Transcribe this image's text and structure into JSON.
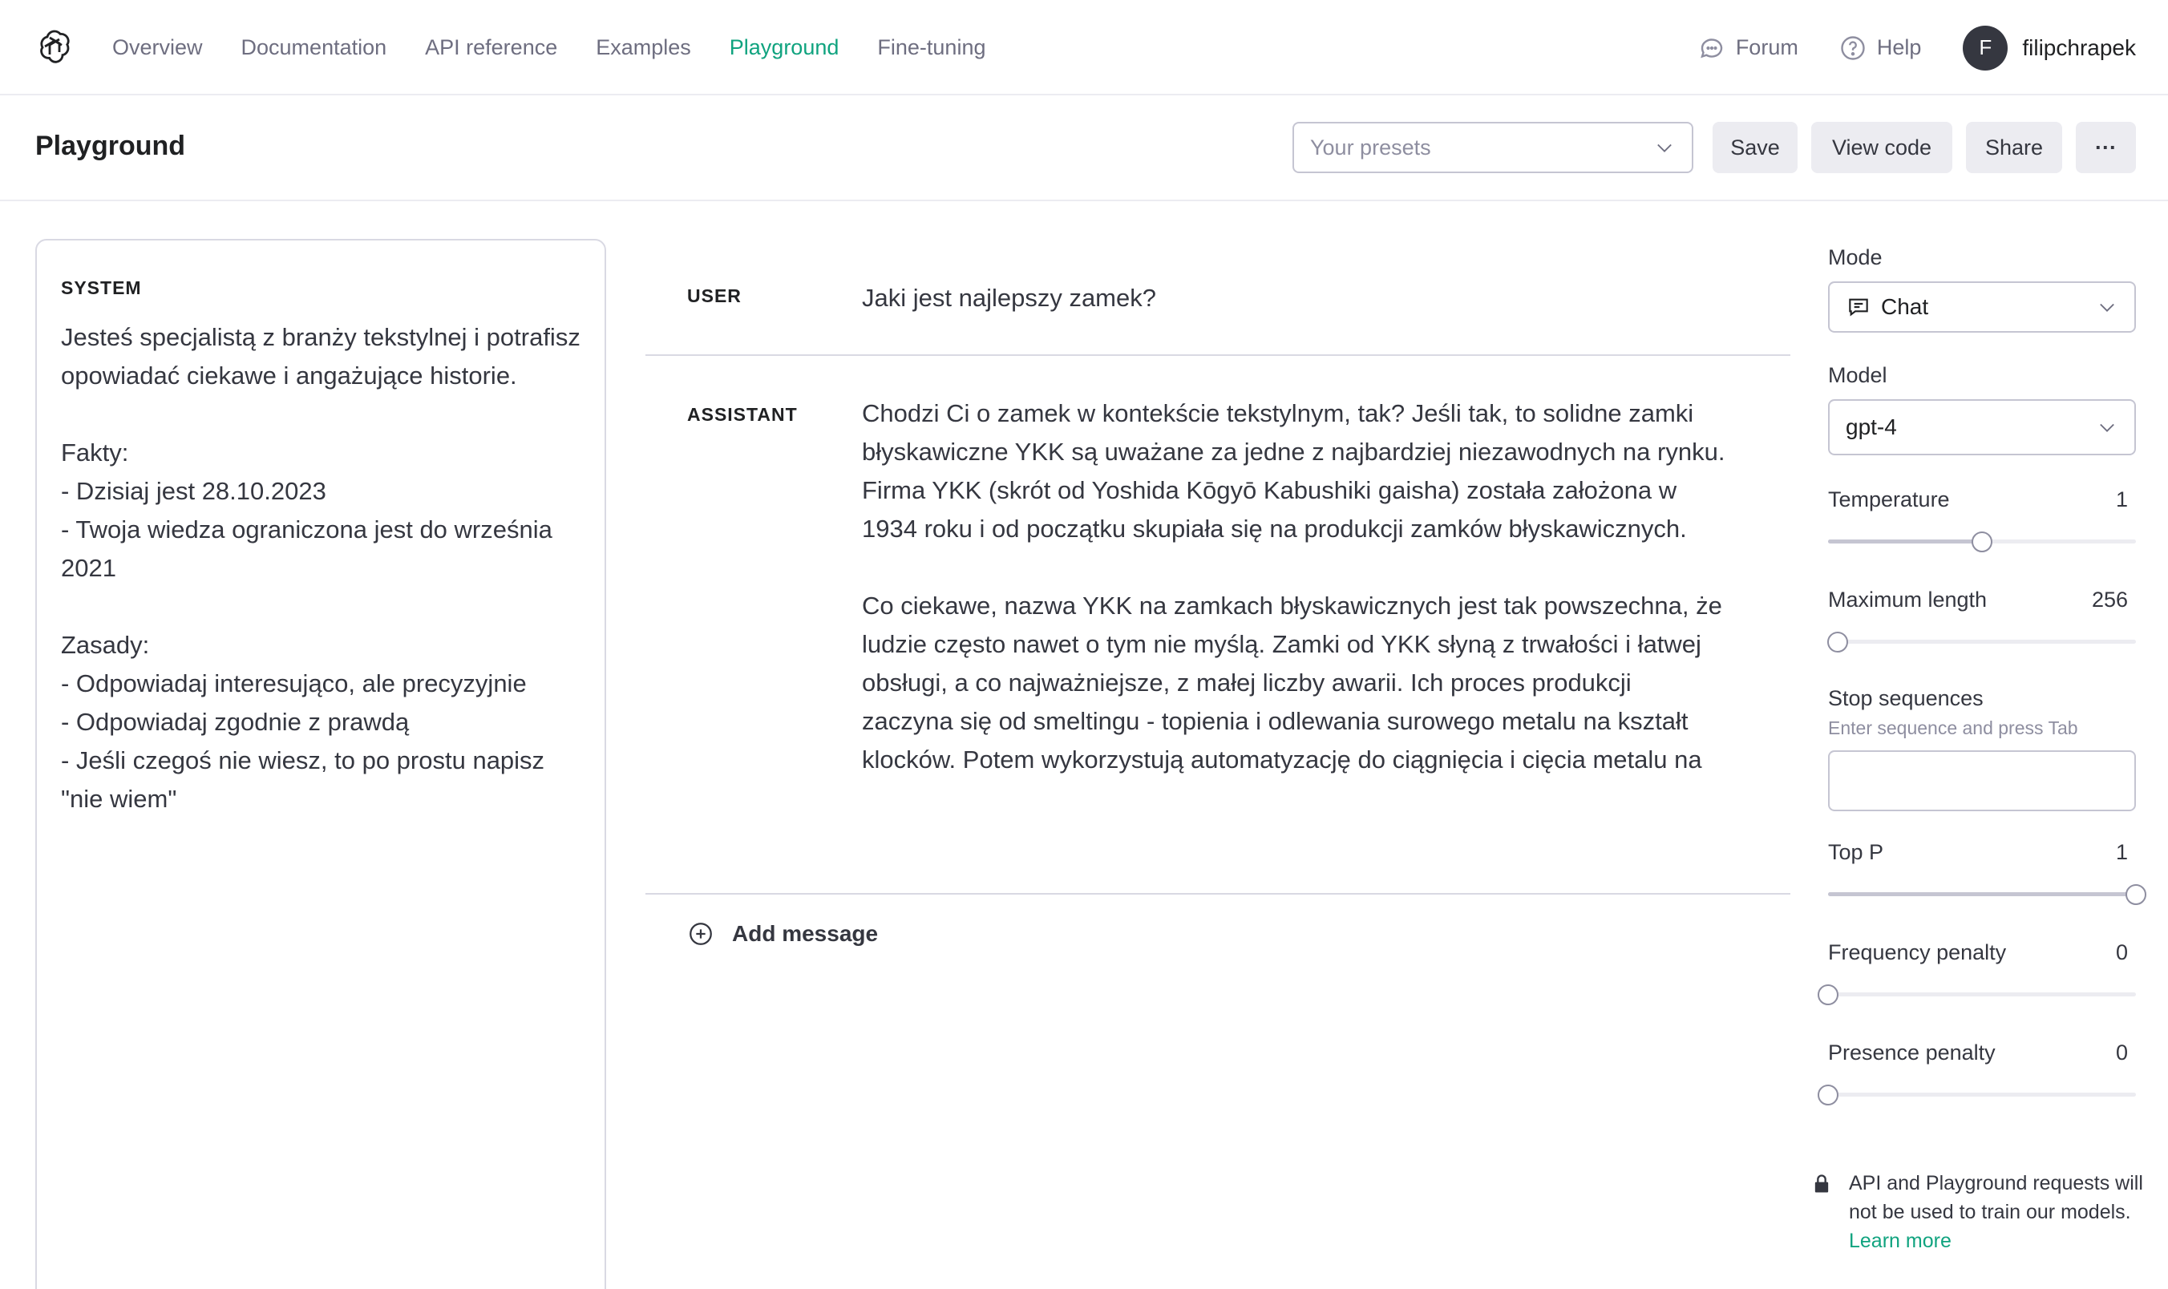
{
  "nav": {
    "links": [
      {
        "label": "Overview",
        "active": false
      },
      {
        "label": "Documentation",
        "active": false
      },
      {
        "label": "API reference",
        "active": false
      },
      {
        "label": "Examples",
        "active": false
      },
      {
        "label": "Playground",
        "active": true
      },
      {
        "label": "Fine-tuning",
        "active": false
      }
    ],
    "forum_label": "Forum",
    "help_label": "Help",
    "avatar_initial": "F",
    "username": "filipchrapek"
  },
  "header": {
    "title": "Playground",
    "presets_placeholder": "Your presets",
    "save_label": "Save",
    "view_code_label": "View code",
    "share_label": "Share",
    "more_label": "···"
  },
  "system": {
    "label": "SYSTEM",
    "text": "Jesteś specjalistą z branży tekstylnej i potrafisz opowiadać ciekawe i angażujące historie.\n\nFakty:\n- Dzisiaj jest 28.10.2023\n- Twoja wiedza ograniczona jest do września 2021\n\nZasady:\n- Odpowiadaj interesująco, ale precyzyjnie\n- Odpowiadaj zgodnie z prawdą\n- Jeśli czegoś nie wiesz, to po prostu napisz \"nie wiem\""
  },
  "messages": [
    {
      "role": "USER",
      "text": "Jaki jest najlepszy zamek?"
    },
    {
      "role": "ASSISTANT",
      "text": "Chodzi Ci o zamek w kontekście tekstylnym, tak? Jeśli tak, to solidne zamki błyskawiczne YKK są uważane za jedne z najbardziej niezawodnych na rynku. Firma YKK (skrót od Yoshida Kōgyō Kabushiki gaisha) została założona w 1934 roku i od początku skupiała się na produkcji zamków błyskawicznych.\n\nCo ciekawe, nazwa YKK na zamkach błyskawicznych jest tak powszechna, że ludzie często nawet o tym nie myślą. Zamki od YKK słyną z trwałości i łatwej obsługi, a co najważniejsze, z małej liczby awarii. Ich proces produkcji zaczyna się od smeltingu - topienia i odlewania surowego metalu na kształt klocków. Potem wykorzystują automatyzację do ciągnięcia i cięcia metalu na"
    }
  ],
  "add_message_label": "Add message",
  "settings": {
    "mode_label": "Mode",
    "mode_value": "Chat",
    "model_label": "Model",
    "model_value": "gpt-4",
    "temperature_label": "Temperature",
    "temperature_value": "1",
    "temperature_fraction": 0.5,
    "max_length_label": "Maximum length",
    "max_length_value": "256",
    "max_length_fraction": 0.03,
    "stop_label": "Stop sequences",
    "stop_hint": "Enter sequence and press Tab",
    "top_p_label": "Top P",
    "top_p_value": "1",
    "top_p_fraction": 1.0,
    "freq_label": "Frequency penalty",
    "freq_value": "0",
    "freq_fraction": 0.0,
    "presence_label": "Presence penalty",
    "presence_value": "0",
    "presence_fraction": 0.0
  },
  "notice": {
    "text": "API and Playground requests will not be used to train our models. ",
    "link": "Learn more"
  },
  "colors": {
    "accent": "#10a37f",
    "text": "#202123",
    "muted": "#6e6e80",
    "border": "#d9d9e3",
    "button_bg": "#ececf1",
    "avatar_bg": "#353740"
  },
  "icons": [
    "openai-logo-icon",
    "forum-icon",
    "help-icon",
    "chevron-down-icon",
    "chat-icon",
    "plus-circle-icon",
    "lock-icon"
  ]
}
